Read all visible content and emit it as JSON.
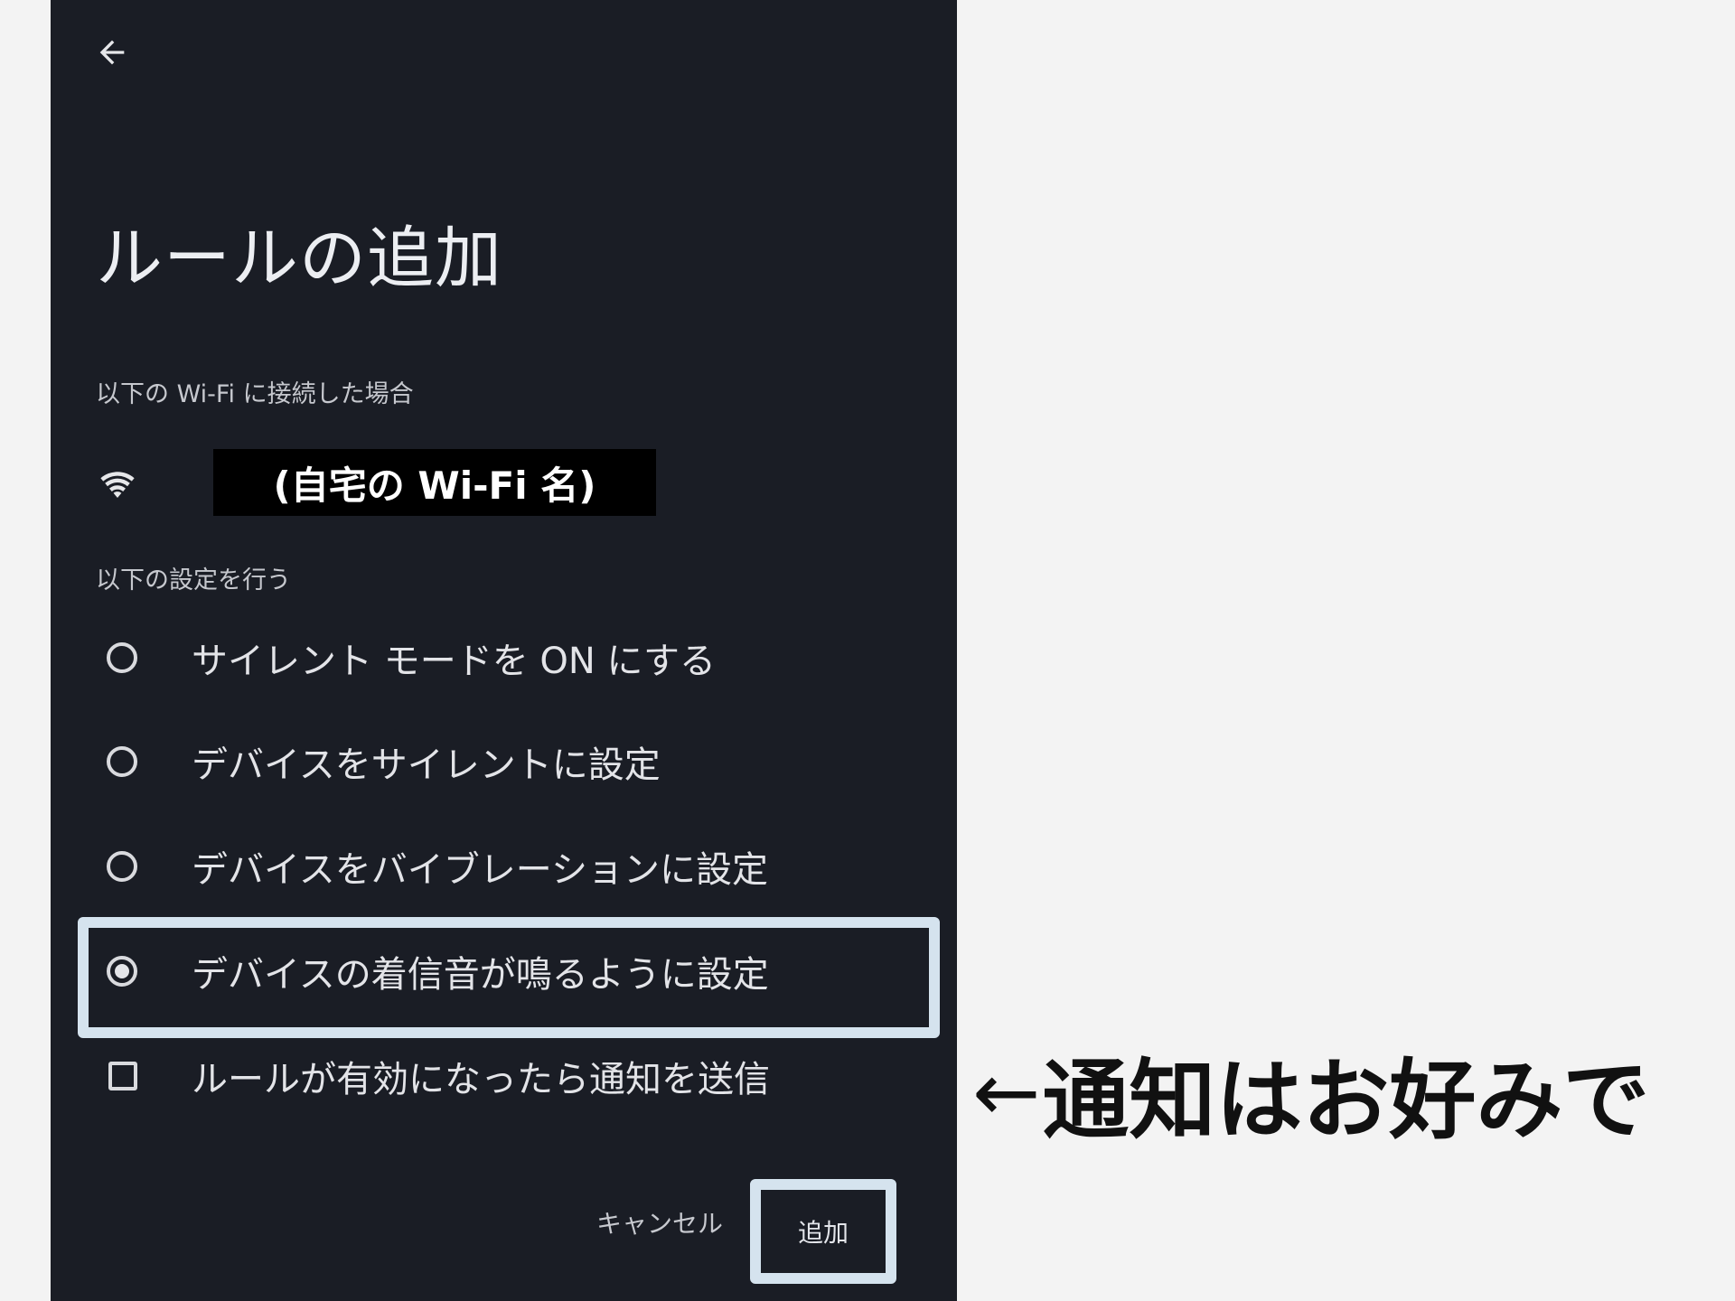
{
  "header": {
    "back_icon": "arrow-left-icon",
    "title": "ルールの追加"
  },
  "wifi_section": {
    "label": "以下の Wi-Fi に接続した場合",
    "icon": "wifi-icon",
    "network_name": "(自宅の Wi-Fi 名)"
  },
  "settings_section": {
    "label": "以下の設定を行う",
    "options": [
      {
        "label": "サイレント モードを ON にする",
        "type": "radio",
        "selected": false
      },
      {
        "label": "デバイスをサイレントに設定",
        "type": "radio",
        "selected": false
      },
      {
        "label": "デバイスをバイブレーションに設定",
        "type": "radio",
        "selected": false
      },
      {
        "label": "デバイスの着信音が鳴るように設定",
        "type": "radio",
        "selected": true
      },
      {
        "label": "ルールが有効になったら通知を送信",
        "type": "checkbox",
        "checked": false
      }
    ]
  },
  "footer": {
    "cancel_label": "キャンセル",
    "add_label": "追加"
  },
  "annotation": {
    "arrow": "←",
    "text": "通知はお好みで"
  },
  "colors": {
    "panel_bg": "#1a1d25",
    "highlight": "#d5e3ee",
    "page_bg": "#f3f3f3"
  }
}
